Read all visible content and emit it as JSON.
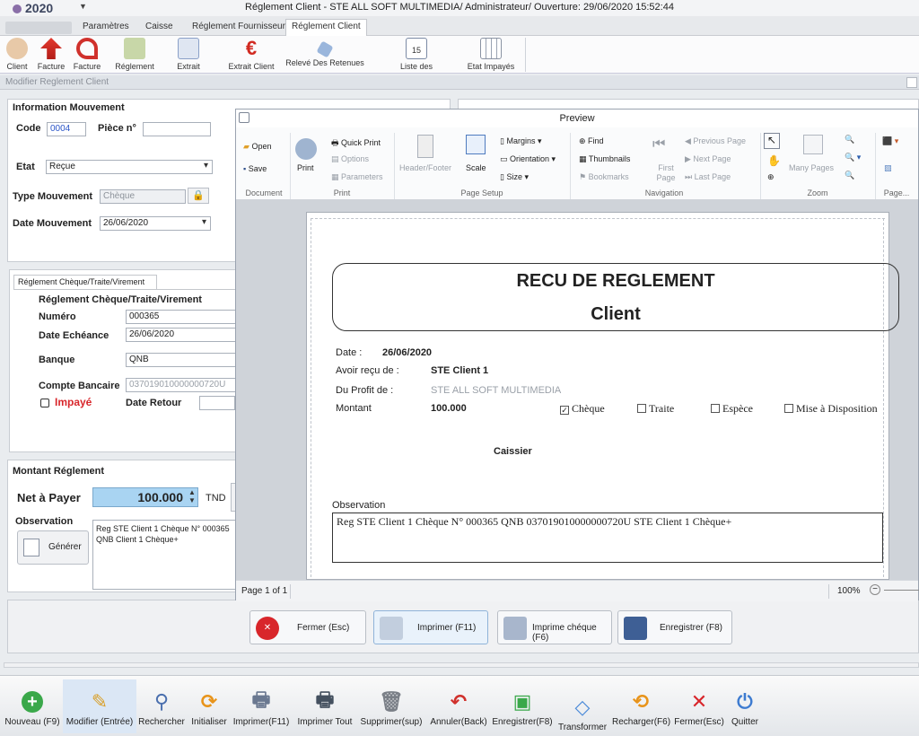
{
  "app": {
    "year": "2020",
    "window_title": "Réglement Client - STE ALL SOFT MULTIMEDIA/ Administrateur/ Ouverture: 29/06/2020 15:52:44"
  },
  "tabs": [
    "Paramètres",
    "Caisse",
    "Réglement Fournisseur",
    "Réglement Client"
  ],
  "ribbon": [
    "Client",
    "Facture",
    "Facture",
    "Réglement",
    "Extrait",
    "Extrait Client",
    "Relevé Des Retenues",
    "Liste des",
    "Etat Impayés"
  ],
  "calendar_day": "15",
  "panel": {
    "title": "Modifier Reglement Client"
  },
  "info": {
    "header": "Information Mouvement",
    "code_label": "Code",
    "code_value": "0004",
    "piece_label": "Pièce n°",
    "etat_label": "Etat",
    "etat_value": "Reçue",
    "type_label": "Type Mouvement",
    "type_value": "Chèque",
    "date_label": "Date Mouvement",
    "date_value": "26/06/2020"
  },
  "cheque": {
    "tab": "Réglement Chèque/Traite/Virement",
    "header": "Réglement Chèque/Traite/Virement",
    "numero_label": "Numéro",
    "numero_value": "000365",
    "echeance_label": "Date Echéance",
    "echeance_value": "26/06/2020",
    "banque_label": "Banque",
    "banque_value": "QNB",
    "compte_label": "Compte Bancaire",
    "compte_value": "037019010000000720U",
    "impaye_label": "Impayé",
    "retour_label": "Date Retour"
  },
  "montant": {
    "header": "Montant Réglement",
    "net_label": "Net à Payer",
    "net_value": "100.000",
    "currency": "TND",
    "obs_label": "Observation",
    "generate_label": "Générer",
    "obs_text": "Reg STE Client 1 Chèque N° 000365 QNB Client 1 Chèque+"
  },
  "preview": {
    "title": "Preview",
    "document": {
      "open": "Open",
      "save": "Save",
      "group": "Document"
    },
    "print": {
      "print": "Print",
      "quick": "Quick Print",
      "options": "Options",
      "params": "Parameters",
      "group": "Print"
    },
    "setup": {
      "hf": "Header/Footer",
      "scale": "Scale",
      "margins": "Margins",
      "orientation": "Orientation",
      "size": "Size",
      "group": "Page Setup"
    },
    "nav": {
      "find": "Find",
      "thumbs": "Thumbnails",
      "bookmarks": "Bookmarks",
      "first": "First Page",
      "prev": "Previous Page",
      "next": "Next Page",
      "last": "Last Page",
      "group": "Navigation"
    },
    "zoom": {
      "many": "Many Pages",
      "group": "Zoom"
    },
    "page_group": "Page...",
    "status_page": "Page 1 of 1",
    "zoom_pct": "100%"
  },
  "receipt": {
    "title": "RECU DE REGLEMENT",
    "subtitle": "Client",
    "date_label": "Date :",
    "date_value": "26/06/2020",
    "recu_label": "Avoir reçu de :",
    "recu_value": "STE Client 1",
    "profit_label": "Du Profit de :",
    "profit_value": "STE ALL SOFT MULTIMEDIA",
    "montant_label": "Montant",
    "montant_value": "100.000",
    "opt_cheque": "Chèque",
    "opt_traite": "Traite",
    "opt_espece": "Espèce",
    "opt_mad": "Mise à Disposition",
    "caissier": "Caissier",
    "obs_label": "Observation",
    "obs_text": "Reg STE Client 1 Chèque N° 000365 QNB 037019010000000720U STE Client 1 Chèque+"
  },
  "actions": {
    "close": "Fermer (Esc)",
    "print": "Imprimer (F11)",
    "print_cheque": "Imprime chéque (F6)",
    "save": "Enregistrer (F8)"
  },
  "toolbar": [
    "Nouveau (F9)",
    "Modifier (Entrée)",
    "Rechercher",
    "Initialiser",
    "Imprimer(F11)",
    "Imprimer Tout",
    "Supprimer(sup)",
    "Annuler(Back)",
    "Enregistrer(F8)",
    "Transformer",
    "Recharger(F6)",
    "Fermer(Esc)",
    "Quitter"
  ],
  "colors": {
    "accent": "#3d7bd0",
    "net_bg": "#a9d4f2",
    "red": "#d8262b",
    "green": "#3aa84a"
  }
}
